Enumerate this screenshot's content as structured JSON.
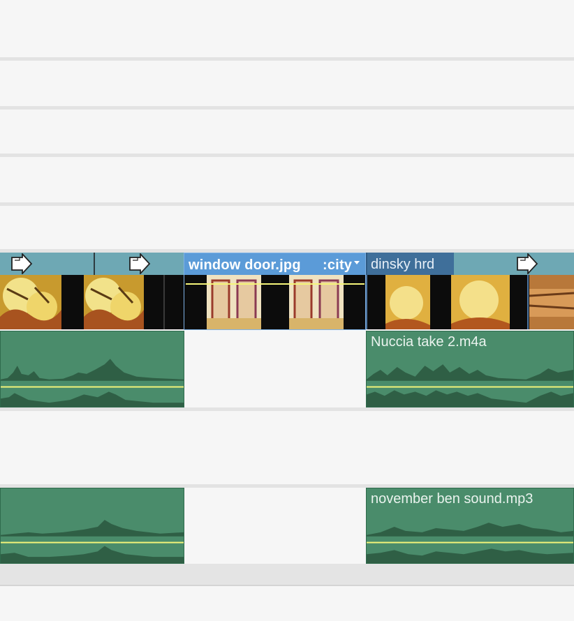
{
  "timeline": {
    "video_track": {
      "clips": [
        {
          "name": "",
          "state": "normal"
        },
        {
          "name": "window door.jpg",
          "suffix": ":city",
          "state": "selected"
        },
        {
          "name": "dinsky hrd",
          "state": "normal"
        }
      ]
    },
    "audio_tracks": [
      {
        "clip_right_title": "Nuccia take 2.m4a"
      },
      {
        "clip_right_title": "november ben sound.mp3"
      }
    ]
  },
  "colors": {
    "video_header": "#6ea8b4",
    "selected_header": "#5b9bd8",
    "audio_clip": "#4a8c6b",
    "volume_line": "#f5f57a",
    "track_background": "#f6f6f6"
  },
  "icons": [
    "transition-arrow-icon",
    "chevron-down-icon"
  ]
}
